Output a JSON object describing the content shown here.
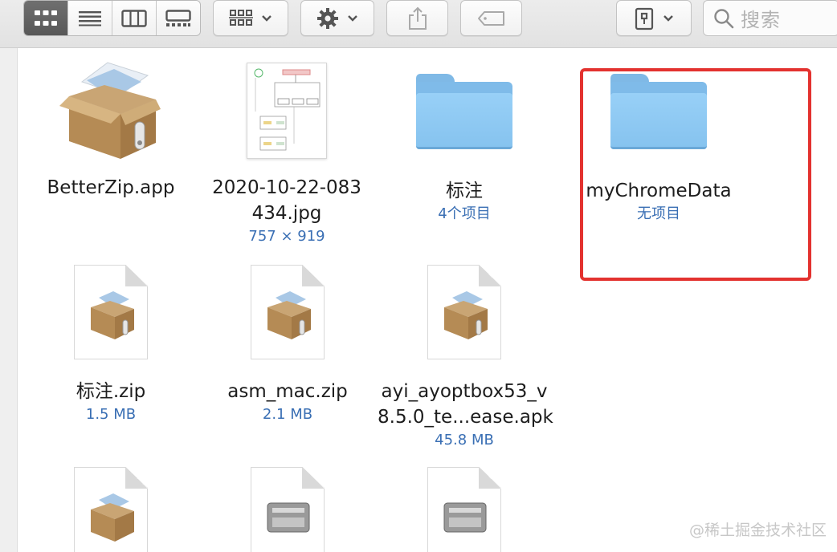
{
  "toolbar": {
    "view_modes": [
      "icon-view-icon",
      "list-view-icon",
      "column-view-icon",
      "gallery-view-icon"
    ],
    "active_view": 0,
    "search_placeholder": "搜索"
  },
  "files": [
    {
      "name": "BetterZip.app",
      "sub": "",
      "kind": "app"
    },
    {
      "name": "2020-10-22-083434.jpg",
      "name_line1": "2020-10-22-083",
      "name_line2": "434.jpg",
      "sub": "757 × 919",
      "kind": "image"
    },
    {
      "name": "标注",
      "sub": "4个项目",
      "kind": "folder"
    },
    {
      "name": "myChromeData",
      "sub": "无项目",
      "kind": "folder"
    },
    {
      "name": "标注.zip",
      "sub": "1.5 MB",
      "kind": "zip"
    },
    {
      "name": "asm_mac.zip",
      "sub": "2.1 MB",
      "kind": "zip"
    },
    {
      "name": "ayi_ayoptbox53_v8.5.0_te...ease.apk",
      "name_line1": "ayi_ayoptbox53_v",
      "name_line2": "8.5.0_te...ease.apk",
      "sub": "45.8 MB",
      "kind": "zip"
    }
  ],
  "watermark": "@稀土掘金技术社区",
  "colors": {
    "folder": "#86c3ef",
    "subtext": "#3a6fb4",
    "highlight": "#e3322f"
  }
}
